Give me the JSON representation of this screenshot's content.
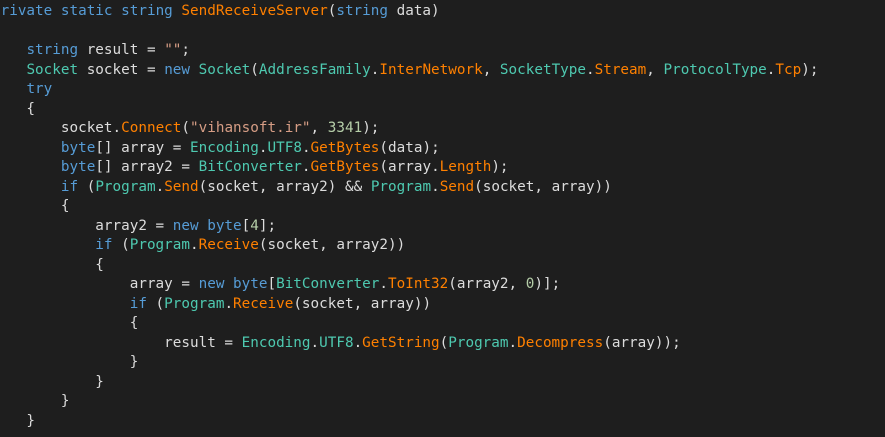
{
  "editor": {
    "lines": [
      [
        [
          "kw",
          "private"
        ],
        [
          "pun",
          " "
        ],
        [
          "kw",
          "static"
        ],
        [
          "pun",
          " "
        ],
        [
          "kw",
          "string"
        ],
        [
          "pun",
          " "
        ],
        [
          "fn",
          "SendReceiveServer"
        ],
        [
          "pun",
          "("
        ],
        [
          "kw",
          "string"
        ],
        [
          "pun",
          " "
        ],
        [
          "var",
          "data"
        ],
        [
          "pun",
          ")"
        ]
      ],
      [
        [
          "pun",
          "{"
        ]
      ],
      [
        [
          "pun",
          "    "
        ],
        [
          "kw",
          "string"
        ],
        [
          "pun",
          " "
        ],
        [
          "var",
          "result"
        ],
        [
          "pun",
          " = "
        ],
        [
          "str",
          "\"\""
        ],
        [
          "pun",
          ";"
        ]
      ],
      [
        [
          "pun",
          "    "
        ],
        [
          "type",
          "Socket"
        ],
        [
          "pun",
          " "
        ],
        [
          "var",
          "socket"
        ],
        [
          "pun",
          " = "
        ],
        [
          "kw",
          "new"
        ],
        [
          "pun",
          " "
        ],
        [
          "type",
          "Socket"
        ],
        [
          "pun",
          "("
        ],
        [
          "type",
          "AddressFamily"
        ],
        [
          "pun",
          "."
        ],
        [
          "prop",
          "InterNetwork"
        ],
        [
          "pun",
          ", "
        ],
        [
          "type",
          "SocketType"
        ],
        [
          "pun",
          "."
        ],
        [
          "prop",
          "Stream"
        ],
        [
          "pun",
          ", "
        ],
        [
          "type",
          "ProtocolType"
        ],
        [
          "pun",
          "."
        ],
        [
          "prop",
          "Tcp"
        ],
        [
          "pun",
          ");"
        ]
      ],
      [
        [
          "pun",
          "    "
        ],
        [
          "kw",
          "try"
        ]
      ],
      [
        [
          "pun",
          "    {"
        ]
      ],
      [
        [
          "pun",
          "        "
        ],
        [
          "var",
          "socket"
        ],
        [
          "pun",
          "."
        ],
        [
          "fn",
          "Connect"
        ],
        [
          "pun",
          "("
        ],
        [
          "str",
          "\"vihansoft.ir\""
        ],
        [
          "pun",
          ", "
        ],
        [
          "num",
          "3341"
        ],
        [
          "pun",
          ");"
        ]
      ],
      [
        [
          "pun",
          "        "
        ],
        [
          "kw",
          "byte"
        ],
        [
          "pun",
          "[] "
        ],
        [
          "var",
          "array"
        ],
        [
          "pun",
          " = "
        ],
        [
          "type",
          "Encoding"
        ],
        [
          "pun",
          "."
        ],
        [
          "cst",
          "UTF8"
        ],
        [
          "pun",
          "."
        ],
        [
          "fn",
          "GetBytes"
        ],
        [
          "pun",
          "("
        ],
        [
          "var",
          "data"
        ],
        [
          "pun",
          ");"
        ]
      ],
      [
        [
          "pun",
          "        "
        ],
        [
          "kw",
          "byte"
        ],
        [
          "pun",
          "[] "
        ],
        [
          "var",
          "array2"
        ],
        [
          "pun",
          " = "
        ],
        [
          "type",
          "BitConverter"
        ],
        [
          "pun",
          "."
        ],
        [
          "fn",
          "GetBytes"
        ],
        [
          "pun",
          "("
        ],
        [
          "var",
          "array"
        ],
        [
          "pun",
          "."
        ],
        [
          "prop",
          "Length"
        ],
        [
          "pun",
          ");"
        ]
      ],
      [
        [
          "pun",
          "        "
        ],
        [
          "kw",
          "if"
        ],
        [
          "pun",
          " ("
        ],
        [
          "type",
          "Program"
        ],
        [
          "pun",
          "."
        ],
        [
          "fn",
          "Send"
        ],
        [
          "pun",
          "("
        ],
        [
          "var",
          "socket"
        ],
        [
          "pun",
          ", "
        ],
        [
          "var",
          "array2"
        ],
        [
          "pun",
          ") && "
        ],
        [
          "type",
          "Program"
        ],
        [
          "pun",
          "."
        ],
        [
          "fn",
          "Send"
        ],
        [
          "pun",
          "("
        ],
        [
          "var",
          "socket"
        ],
        [
          "pun",
          ", "
        ],
        [
          "var",
          "array"
        ],
        [
          "pun",
          "))"
        ]
      ],
      [
        [
          "pun",
          "        {"
        ]
      ],
      [
        [
          "pun",
          "            "
        ],
        [
          "var",
          "array2"
        ],
        [
          "pun",
          " = "
        ],
        [
          "kw",
          "new"
        ],
        [
          "pun",
          " "
        ],
        [
          "kw",
          "byte"
        ],
        [
          "pun",
          "["
        ],
        [
          "num",
          "4"
        ],
        [
          "pun",
          "];"
        ]
      ],
      [
        [
          "pun",
          "            "
        ],
        [
          "kw",
          "if"
        ],
        [
          "pun",
          " ("
        ],
        [
          "type",
          "Program"
        ],
        [
          "pun",
          "."
        ],
        [
          "fn",
          "Receive"
        ],
        [
          "pun",
          "("
        ],
        [
          "var",
          "socket"
        ],
        [
          "pun",
          ", "
        ],
        [
          "var",
          "array2"
        ],
        [
          "pun",
          "))"
        ]
      ],
      [
        [
          "pun",
          "            {"
        ]
      ],
      [
        [
          "pun",
          "                "
        ],
        [
          "var",
          "array"
        ],
        [
          "pun",
          " = "
        ],
        [
          "kw",
          "new"
        ],
        [
          "pun",
          " "
        ],
        [
          "kw",
          "byte"
        ],
        [
          "pun",
          "["
        ],
        [
          "type",
          "BitConverter"
        ],
        [
          "pun",
          "."
        ],
        [
          "fn",
          "ToInt32"
        ],
        [
          "pun",
          "("
        ],
        [
          "var",
          "array2"
        ],
        [
          "pun",
          ", "
        ],
        [
          "num",
          "0"
        ],
        [
          "pun",
          ")];"
        ]
      ],
      [
        [
          "pun",
          "                "
        ],
        [
          "kw",
          "if"
        ],
        [
          "pun",
          " ("
        ],
        [
          "type",
          "Program"
        ],
        [
          "pun",
          "."
        ],
        [
          "fn",
          "Receive"
        ],
        [
          "pun",
          "("
        ],
        [
          "var",
          "socket"
        ],
        [
          "pun",
          ", "
        ],
        [
          "var",
          "array"
        ],
        [
          "pun",
          "))"
        ]
      ],
      [
        [
          "pun",
          "                {"
        ]
      ],
      [
        [
          "pun",
          "                    "
        ],
        [
          "var",
          "result"
        ],
        [
          "pun",
          " = "
        ],
        [
          "type",
          "Encoding"
        ],
        [
          "pun",
          "."
        ],
        [
          "cst",
          "UTF8"
        ],
        [
          "pun",
          "."
        ],
        [
          "fn",
          "GetString"
        ],
        [
          "pun",
          "("
        ],
        [
          "type",
          "Program"
        ],
        [
          "pun",
          "."
        ],
        [
          "fn",
          "Decompress"
        ],
        [
          "pun",
          "("
        ],
        [
          "var",
          "array"
        ],
        [
          "pun",
          "));"
        ]
      ],
      [
        [
          "pun",
          "                }"
        ]
      ],
      [
        [
          "pun",
          "            }"
        ]
      ],
      [
        [
          "pun",
          "        }"
        ]
      ],
      [
        [
          "pun",
          "    }"
        ]
      ]
    ]
  }
}
